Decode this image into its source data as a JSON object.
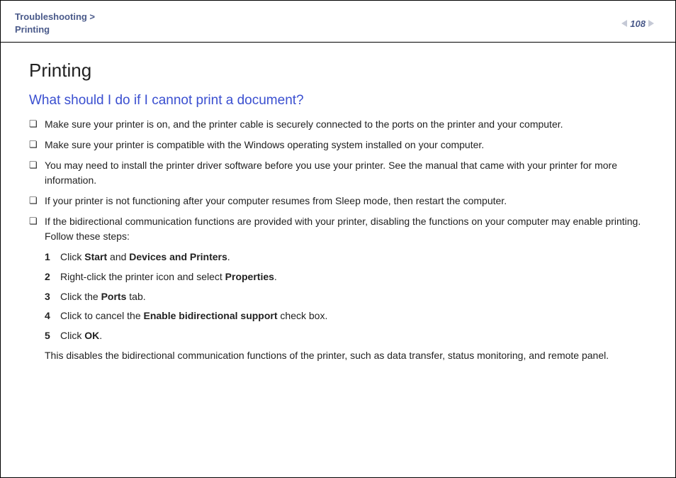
{
  "header": {
    "breadcrumb_section": "Troubleshooting >",
    "breadcrumb_page": "Printing",
    "page_number": "108"
  },
  "main": {
    "title": "Printing",
    "subtitle": "What should I do if I cannot print a document?",
    "bullets": [
      "Make sure your printer is on, and the printer cable is securely connected to the ports on the printer and your computer.",
      "Make sure your printer is compatible with the Windows operating system installed on your computer.",
      "You may need to install the printer driver software before you use your printer. See the manual that came with your printer for more information.",
      "If your printer is not functioning after your computer resumes from Sleep mode, then restart the computer.",
      "If the bidirectional communication functions are provided with your printer, disabling the functions on your computer may enable printing. Follow these steps:"
    ],
    "steps": {
      "s1": {
        "pre": "Click ",
        "b1": "Start",
        "mid": " and ",
        "b2": "Devices and Printers",
        "post": "."
      },
      "s2": {
        "pre": "Right-click the printer icon and select ",
        "b1": "Properties",
        "post": "."
      },
      "s3": {
        "pre": "Click the ",
        "b1": "Ports",
        "post": " tab."
      },
      "s4": {
        "pre": "Click to cancel the ",
        "b1": "Enable bidirectional support",
        "post": " check box."
      },
      "s5": {
        "pre": "Click ",
        "b1": "OK",
        "post": "."
      }
    },
    "closing": "This disables the bidirectional communication functions of the printer, such as data transfer, status monitoring, and remote panel."
  }
}
